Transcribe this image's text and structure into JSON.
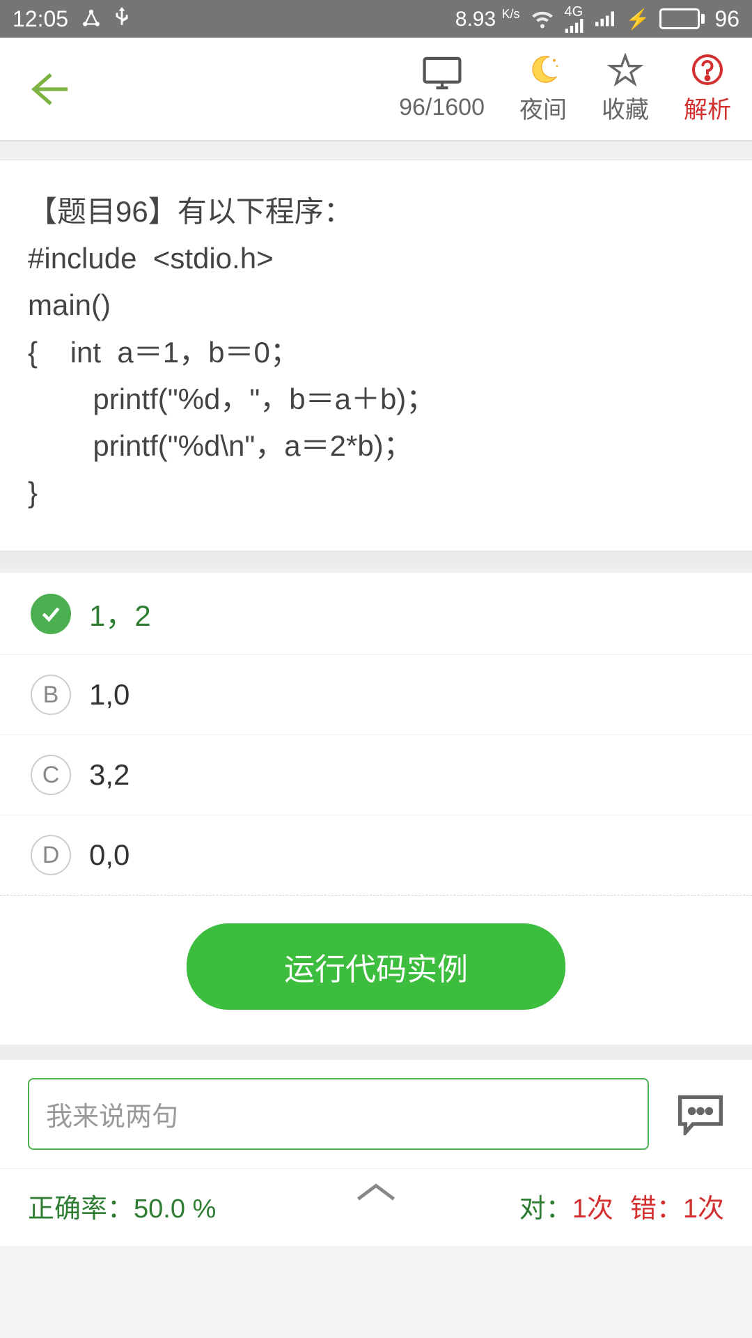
{
  "status": {
    "time": "12:05",
    "speed": "8.93",
    "speed_unit": "K/s",
    "battery": "96"
  },
  "header": {
    "counter": "96/1600",
    "night": "夜间",
    "favorite": "收藏",
    "analysis": "解析"
  },
  "question": {
    "title": "【题目96】有以下程序：",
    "line1": "#include  <stdio.h>",
    "line2": "main()",
    "line3": "{    int  a＝1，b＝0；",
    "line4": "        printf(\"%d，\"，b＝a＋b)；",
    "line5": "        printf(\"%d\\n\"，a＝2*b)；",
    "line6": "}"
  },
  "options": {
    "a": "1，2",
    "b_letter": "B",
    "b": "1,0",
    "c_letter": "C",
    "c": "3,2",
    "d_letter": "D",
    "d": "0,0"
  },
  "run_button": "运行代码实例",
  "comment": {
    "placeholder": "我来说两句"
  },
  "stats": {
    "accuracy_label": "正确率：",
    "accuracy_value": "50.0 %",
    "correct_label": "对：",
    "correct_value": "1次",
    "wrong_label": "错：",
    "wrong_value": "1次"
  }
}
